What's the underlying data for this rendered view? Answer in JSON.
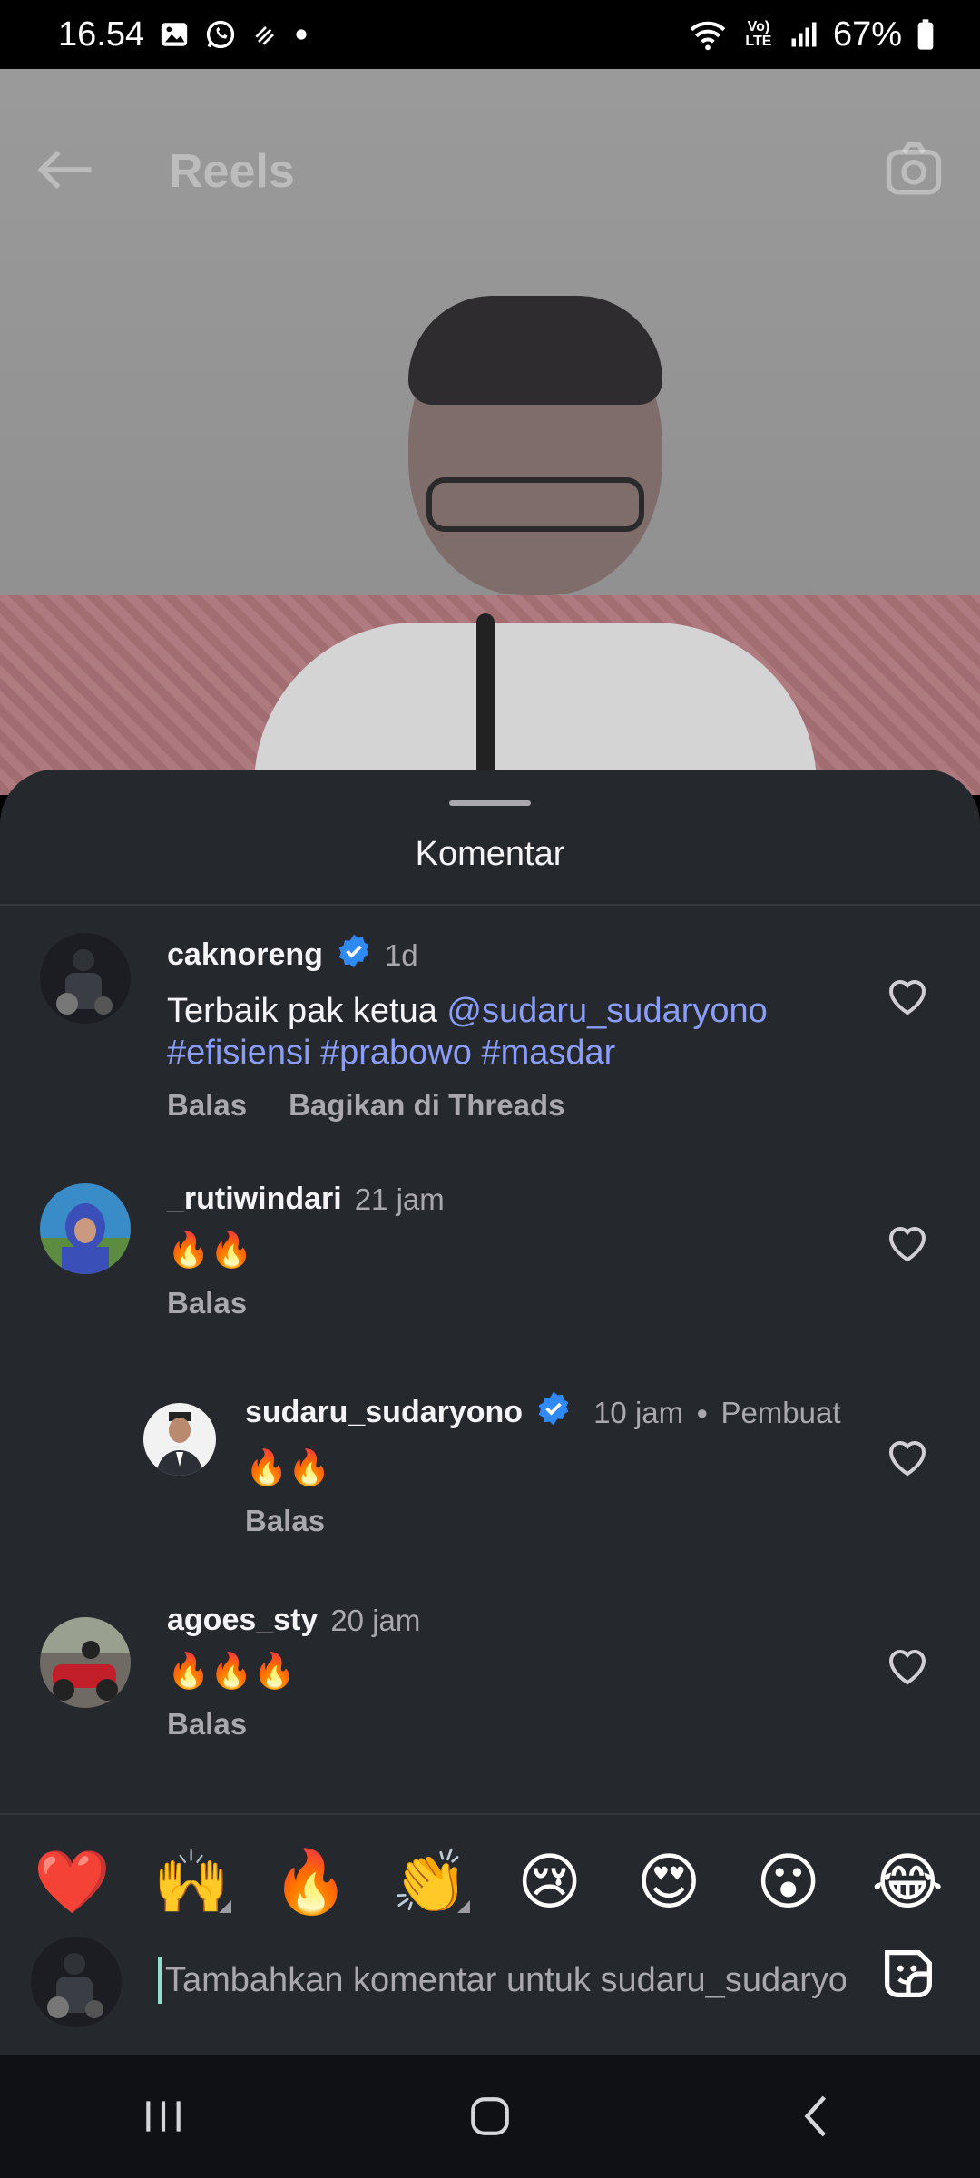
{
  "status_bar": {
    "time": "16.54",
    "battery": "67%",
    "network": "Vo) LTE",
    "icons_left": [
      "gallery-icon",
      "whatsapp-icon",
      "data-transfer-icon",
      "dot-icon"
    ],
    "icons_right": [
      "wifi-icon",
      "volte-icon",
      "signal-icon",
      "battery-icon"
    ]
  },
  "reel": {
    "title": "Reels",
    "back_icon": "back-arrow-icon",
    "camera_icon": "camera-icon"
  },
  "comments_sheet": {
    "title": "Komentar",
    "comments": [
      {
        "username": "caknoreng",
        "verified": true,
        "time": "1d",
        "text_plain": "Terbaik pak ketua ",
        "mention": "@sudaru_sudaryono",
        "hashtags": "#efisiensi #prabowo #masdar",
        "actions": [
          "Balas",
          "Bagikan di Threads"
        ]
      },
      {
        "username": "_rutiwindari",
        "verified": false,
        "time": "21 jam",
        "text_plain": "🔥🔥",
        "actions": [
          "Balas"
        ]
      },
      {
        "username": "sudaru_sudaryono",
        "verified": true,
        "time": "10 jam",
        "creator_label": "Pembuat",
        "text_plain": "🔥🔥",
        "actions": [
          "Balas"
        ],
        "is_reply": true
      },
      {
        "username": "agoes_sty",
        "verified": false,
        "time": "20 jam",
        "text_plain": "🔥🔥🔥",
        "actions": [
          "Balas"
        ]
      }
    ]
  },
  "emoji_bar": {
    "emojis": [
      "❤️",
      "🙌",
      "🔥",
      "👏",
      "😢",
      "😍",
      "😮",
      "😂"
    ]
  },
  "comment_input": {
    "placeholder": "Tambahkan komentar untuk sudaru_sudaryono..."
  },
  "colors": {
    "sheet_bg": "#25282d",
    "link": "#8a9dfa",
    "verified": "#2f8af5",
    "muted_text": "#a8a8ae"
  }
}
